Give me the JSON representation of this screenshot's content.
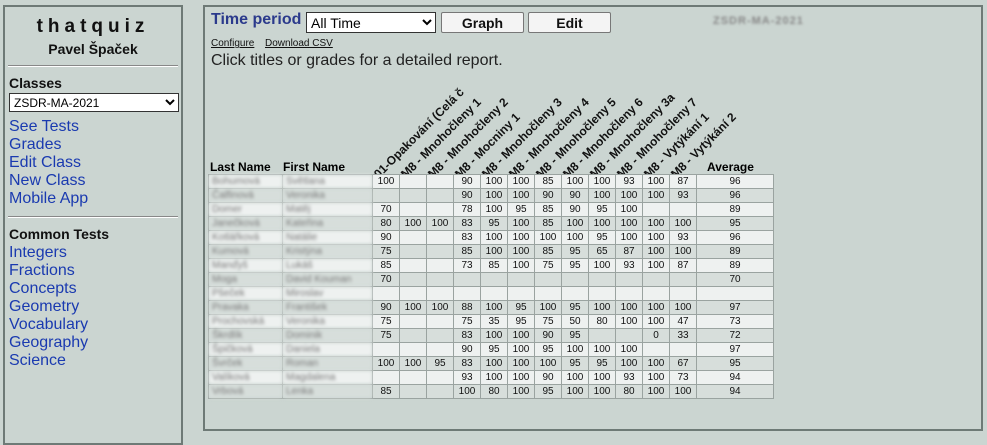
{
  "sidebar": {
    "brand": "thatquiz",
    "teacher": "Pavel Špaček",
    "classes_title": "Classes",
    "selected_class": "ZSDR-MA-2021",
    "nav": [
      "See Tests",
      "Grades",
      "Edit Class",
      "New Class",
      "Mobile App"
    ],
    "common_title": "Common Tests",
    "common": [
      "Integers",
      "Fractions",
      "Concepts",
      "Geometry",
      "Vocabulary",
      "Geography",
      "Science"
    ]
  },
  "main": {
    "time_period_label": "Time period",
    "time_period_value": "All Time",
    "graph_label": "Graph",
    "edit_label": "Edit",
    "class_code": "ZSDR-MA-2021",
    "configure_label": "Configure",
    "csv_label": "Download CSV",
    "instruction": "Click titles or grades for a detailed report."
  },
  "table": {
    "last_name_header": "Last Name",
    "first_name_header": "First Name",
    "average_header": "Average",
    "columns": [
      "01-Opakování (Celá č",
      "M8 - Mnohočleny 1",
      "M8 - Mnohočleny 2",
      "M8 - Mocniny 1",
      "M8 - Mnohočleny 3",
      "M8 - Mnohočleny 4",
      "M8 - Mnohočleny 5",
      "M8 - Mnohočleny 6",
      "M8 - Mnohočleny 3a",
      "M8 - Mnohočleny 7",
      "M8 - Vytýkání 1",
      "M8 - Vytýkání 2"
    ],
    "rows": [
      {
        "last": "Bohumová",
        "first": "Světlana",
        "scores": [
          "100",
          "",
          "",
          "90",
          "100",
          "100",
          "85",
          "100",
          "100",
          "93",
          "100",
          "87"
        ],
        "average": "96"
      },
      {
        "last": "Čalfinová",
        "first": "Veronika",
        "scores": [
          "",
          "",
          "",
          "90",
          "100",
          "100",
          "90",
          "90",
          "100",
          "100",
          "100",
          "93"
        ],
        "average": "96"
      },
      {
        "last": "Domer",
        "first": "Matěj",
        "scores": [
          "70",
          "",
          "",
          "78",
          "100",
          "95",
          "85",
          "90",
          "95",
          "100",
          "",
          ""
        ],
        "average": "89"
      },
      {
        "last": "Janečková",
        "first": "Kateřina",
        "scores": [
          "80",
          "100",
          "100",
          "83",
          "95",
          "100",
          "85",
          "100",
          "100",
          "100",
          "100",
          "100"
        ],
        "average": "95"
      },
      {
        "last": "Kotlářková",
        "first": "Natálie",
        "scores": [
          "90",
          "",
          "",
          "83",
          "100",
          "100",
          "100",
          "100",
          "95",
          "100",
          "100",
          "93"
        ],
        "average": "96"
      },
      {
        "last": "Kumová",
        "first": "Kristýna",
        "scores": [
          "75",
          "",
          "",
          "85",
          "100",
          "100",
          "85",
          "95",
          "65",
          "87",
          "100",
          "100"
        ],
        "average": "89"
      },
      {
        "last": "Manďyš",
        "first": "Lukáš",
        "scores": [
          "85",
          "",
          "",
          "73",
          "85",
          "100",
          "75",
          "95",
          "100",
          "93",
          "100",
          "87"
        ],
        "average": "89"
      },
      {
        "last": "Moga",
        "first": "David Kouman",
        "scores": [
          "70",
          "",
          "",
          "",
          "",
          "",
          "",
          "",
          "",
          "",
          "",
          ""
        ],
        "average": "70"
      },
      {
        "last": "Pšeček",
        "first": "Miroslav",
        "scores": [
          "",
          "",
          "",
          "",
          "",
          "",
          "",
          "",
          "",
          "",
          "",
          ""
        ],
        "average": ""
      },
      {
        "last": "Pravaka",
        "first": "František",
        "scores": [
          "90",
          "100",
          "100",
          "88",
          "100",
          "95",
          "100",
          "95",
          "100",
          "100",
          "100",
          "100"
        ],
        "average": "97"
      },
      {
        "last": "Prochovská",
        "first": "Veronika",
        "scores": [
          "75",
          "",
          "",
          "75",
          "35",
          "95",
          "75",
          "50",
          "80",
          "100",
          "100",
          "47"
        ],
        "average": "73"
      },
      {
        "last": "Škrdlík",
        "first": "Dominik",
        "scores": [
          "75",
          "",
          "",
          "83",
          "100",
          "100",
          "90",
          "95",
          "",
          "",
          "0",
          "33"
        ],
        "average": "72"
      },
      {
        "last": "Špičková",
        "first": "Daniela",
        "scores": [
          "",
          "",
          "",
          "90",
          "95",
          "100",
          "95",
          "100",
          "100",
          "100",
          "",
          ""
        ],
        "average": "97"
      },
      {
        "last": "Švrček",
        "first": "Roman",
        "scores": [
          "100",
          "100",
          "95",
          "83",
          "100",
          "100",
          "100",
          "95",
          "95",
          "100",
          "100",
          "67"
        ],
        "average": "95"
      },
      {
        "last": "Valíková",
        "first": "Magdalena",
        "scores": [
          "",
          "",
          "",
          "93",
          "100",
          "100",
          "90",
          "100",
          "100",
          "93",
          "100",
          "73"
        ],
        "average": "94"
      },
      {
        "last": "Vrbová",
        "first": "Lenka",
        "scores": [
          "85",
          "",
          "",
          "100",
          "80",
          "100",
          "95",
          "100",
          "100",
          "80",
          "100",
          "100"
        ],
        "average": "94"
      }
    ]
  },
  "colors": {
    "page_bg": "#cbd5d1",
    "link": "#1a3ab0",
    "title": "#2b3a8c"
  }
}
